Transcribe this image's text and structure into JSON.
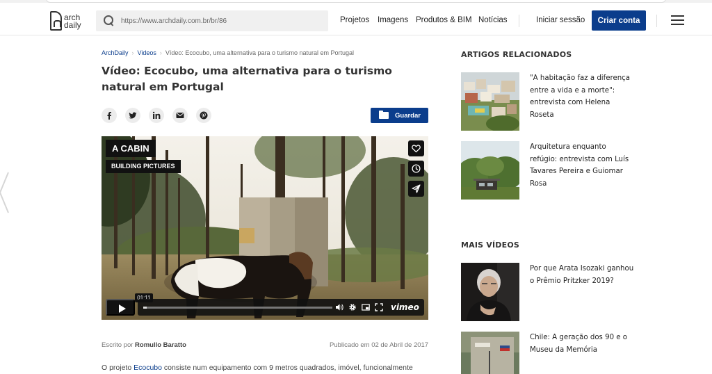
{
  "header": {
    "logo_line1": "arch",
    "logo_line2": "daily",
    "search_value": "https://www.archdaily.com.br/br/86",
    "nav": [
      "Projetos",
      "Imagens",
      "Produtos & BIM",
      "Notícias"
    ],
    "login": "Iniciar sessão",
    "signup": "Criar conta"
  },
  "breadcrumb": [
    "ArchDaily",
    "Videos",
    "Vídeo: Ecocubo, uma alternativa para o turismo natural em Portugal"
  ],
  "article": {
    "title": "Vídeo: Ecocubo, uma alternativa para o turismo natural em Portugal",
    "save_label": "Guardar",
    "author_prefix": "Escrito por",
    "author": "Romullo Baratto",
    "published": "Publicado em 02 de Abril de 2017",
    "body_prefix": "O projeto",
    "body_link": "Ecocubo",
    "body_rest": "consiste num equipamento com 9 metros quadrados, imóvel, funcionalmente"
  },
  "video": {
    "tag1": "A CABIN",
    "tag2": "BUILDING PICTURES",
    "time": "01:11",
    "brand": "vimeo",
    "progress": 0.02
  },
  "sidebar": {
    "related_heading": "ARTIGOS RELACIONADOS",
    "related": [
      {
        "title": "\"A habitação faz a diferença entre a vida e a morte\": entrevista com Helena Roseta"
      },
      {
        "title": "Arquitetura enquanto refúgio: entrevista com Luís Tavares Pereira e Guiomar Rosa"
      }
    ],
    "videos_heading": "MAIS VÍDEOS",
    "videos": [
      {
        "title": "Por que Arata Isozaki ganhou o Prêmio Pritzker 2019?"
      },
      {
        "title": "Chile: A geração dos 90 e o Museu da Memória"
      }
    ]
  },
  "colors": {
    "brand_blue": "#0b3d8c"
  }
}
